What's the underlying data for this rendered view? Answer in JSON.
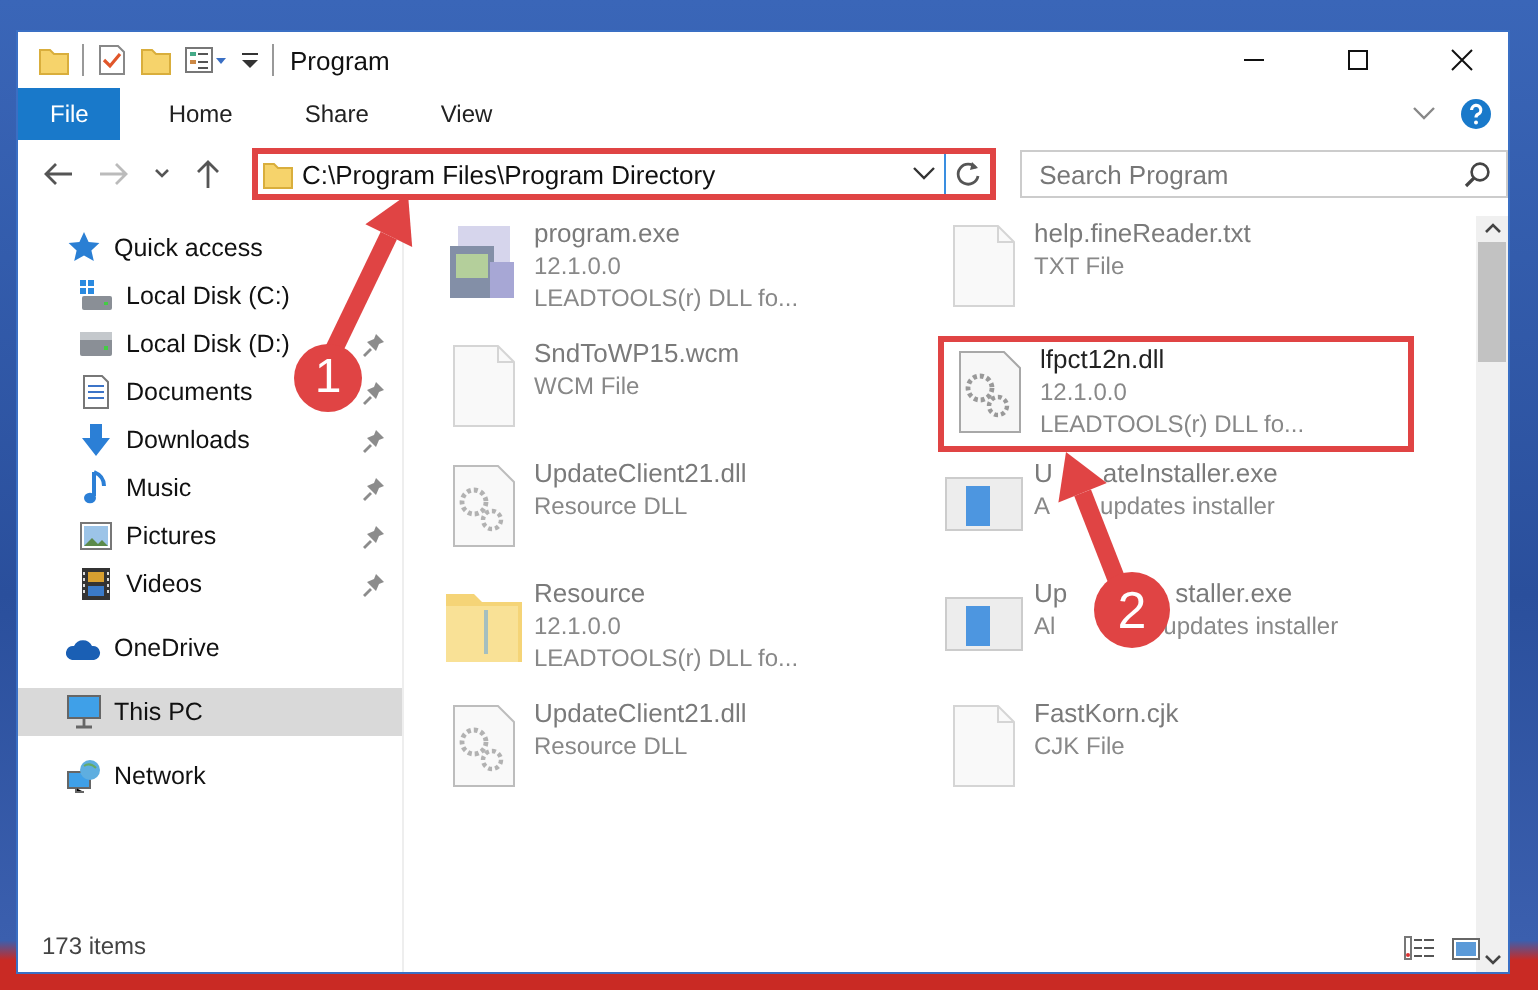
{
  "window": {
    "title": "Program"
  },
  "ribbon_tabs": [
    {
      "label": "File",
      "selected": true
    },
    {
      "label": "Home",
      "selected": false
    },
    {
      "label": "Share",
      "selected": false
    },
    {
      "label": "View",
      "selected": false
    }
  ],
  "address_bar": {
    "path": "C:\\Program Files\\Program Directory",
    "highlighted": true
  },
  "search": {
    "placeholder": "Search Program"
  },
  "sidebar": {
    "items": [
      {
        "label": "Quick access",
        "selected": false,
        "children": [
          {
            "label": "Local Disk (C:)",
            "selected": false
          },
          {
            "label": "Local Disk (D:)",
            "pinned": true,
            "selected": false
          },
          {
            "label": "Documents",
            "pinned": true,
            "selected": false
          },
          {
            "label": "Downloads",
            "pinned": true,
            "selected": false
          },
          {
            "label": "Music",
            "pinned": true,
            "selected": false
          },
          {
            "label": "Pictures",
            "pinned": true,
            "selected": false
          },
          {
            "label": "Videos",
            "pinned": true,
            "selected": false
          }
        ]
      },
      {
        "label": "OneDrive",
        "selected": false
      },
      {
        "label": "This PC",
        "selected": true
      },
      {
        "label": "Network",
        "selected": false
      }
    ]
  },
  "files": [
    {
      "kind": "app",
      "name": "program.exe",
      "details": [
        "12.1.0.0",
        "LEADTOOLS(r) DLL fo..."
      ],
      "blurred": true,
      "highlighted": false
    },
    {
      "kind": "document",
      "name": "help.fineReader.txt",
      "details": [
        "TXT File"
      ],
      "blurred": true,
      "highlighted": false
    },
    {
      "kind": "document",
      "name": "SndToWP15.wcm",
      "details": [
        "WCM File"
      ],
      "blurred": true,
      "highlighted": false
    },
    {
      "kind": "dll",
      "name": "lfpct12n.dll",
      "details": [
        "12.1.0.0",
        "LEADTOOLS(r) DLL fo..."
      ],
      "blurred": false,
      "highlighted": true
    },
    {
      "kind": "dll",
      "name": "UpdateClient21.dll",
      "details": [
        "Resource DLL"
      ],
      "blurred": true,
      "highlighted": false
    },
    {
      "kind": "installer",
      "name": [
        "U",
        "ateInstaller.exe"
      ],
      "details": [
        [
          "A",
          "updates installer"
        ]
      ],
      "blurred": true,
      "highlighted": false
    },
    {
      "kind": "folder",
      "name": "Resource",
      "details": [
        "12.1.0.0",
        "LEADTOOLS(r) DLL fo..."
      ],
      "blurred": true,
      "highlighted": false
    },
    {
      "kind": "installer",
      "name": [
        "Up",
        "staller.exe"
      ],
      "details": [
        [
          "Al",
          "updates installer"
        ]
      ],
      "blurred": true,
      "highlighted": false
    },
    {
      "kind": "dll",
      "name": "UpdateClient21.dll",
      "details": [
        "Resource DLL"
      ],
      "blurred": true,
      "highlighted": false
    },
    {
      "kind": "document",
      "name": "FastKorn.cjk",
      "details": [
        "CJK File"
      ],
      "blurred": true,
      "highlighted": false
    }
  ],
  "status_bar": {
    "item_count": "173 items"
  },
  "annotations": [
    {
      "number": "1"
    },
    {
      "number": "2"
    }
  ]
}
